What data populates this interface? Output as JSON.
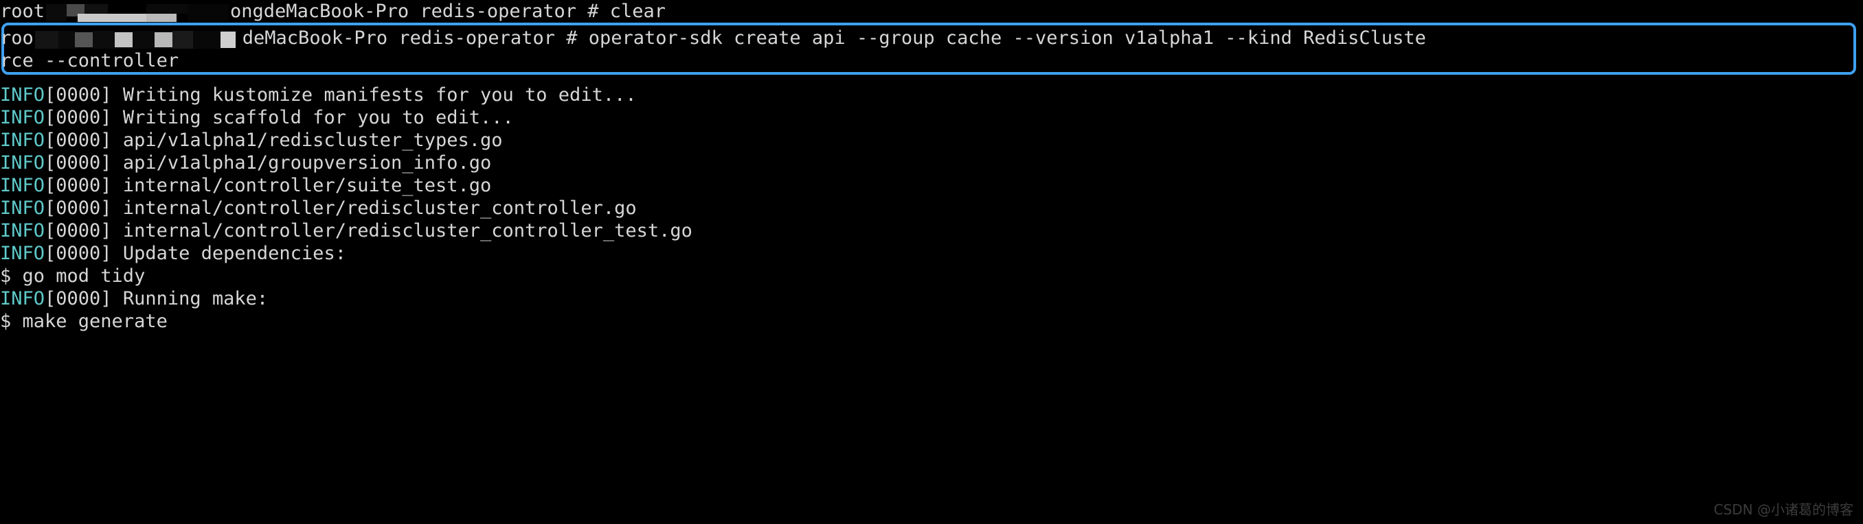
{
  "terminal": {
    "title": "root@ongdeMacBook-Pro redis-operator",
    "background_color": "#000000",
    "foreground_color": "#d6d6d6",
    "info_color": "#5fc9c9",
    "highlight_color": "#3fa0ef",
    "prompt_line_1": {
      "user": "root",
      "at": "@",
      "host_visible": "ongdeMacBook-Pro",
      "cwd": "redis-operator",
      "prompt_char": "#",
      "command": "clear"
    },
    "prompt_line_2": {
      "user": "roo",
      "host_visible": "deMacBook-Pro",
      "cwd": "redis-operator",
      "prompt_char": "#",
      "command_part_1": "operator-sdk create api --group cache --version v1alpha1 --kind RedisCluste",
      "command_part_2": "rce --controller"
    },
    "output_lines": [
      {
        "tag": "INFO",
        "time": "[0000]",
        "message": "Writing kustomize manifests for you to edit..."
      },
      {
        "tag": "INFO",
        "time": "[0000]",
        "message": "Writing scaffold for you to edit..."
      },
      {
        "tag": "INFO",
        "time": "[0000]",
        "message": "api/v1alpha1/rediscluster_types.go"
      },
      {
        "tag": "INFO",
        "time": "[0000]",
        "message": "api/v1alpha1/groupversion_info.go"
      },
      {
        "tag": "INFO",
        "time": "[0000]",
        "message": "internal/controller/suite_test.go"
      },
      {
        "tag": "INFO",
        "time": "[0000]",
        "message": "internal/controller/rediscluster_controller.go"
      },
      {
        "tag": "INFO",
        "time": "[0000]",
        "message": "internal/controller/rediscluster_controller_test.go"
      },
      {
        "tag": "INFO",
        "time": "[0000]",
        "message": "Update dependencies:"
      },
      {
        "tag": "",
        "time": "",
        "message": "$ go mod tidy"
      },
      {
        "tag": "INFO",
        "time": "[0000]",
        "message": "Running make:"
      },
      {
        "tag": "",
        "time": "",
        "message": "$ make generate"
      }
    ]
  },
  "watermark": {
    "text": "CSDN @小诸葛的博客"
  }
}
